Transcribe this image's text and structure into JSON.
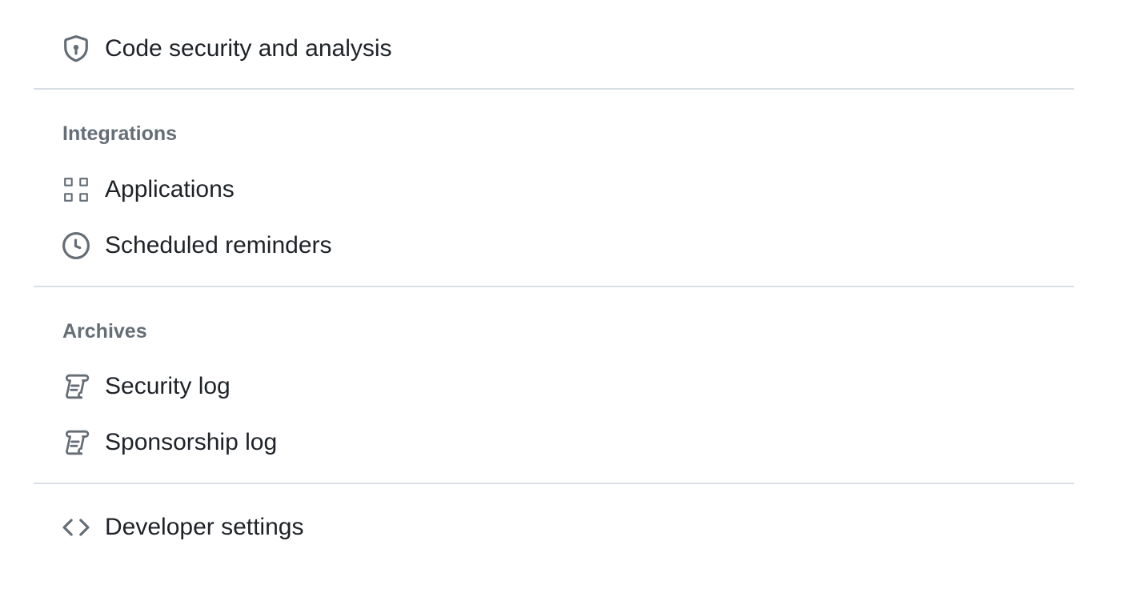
{
  "sections": {
    "security": {
      "items": [
        {
          "label": "Code security and analysis",
          "icon": "shield-lock-icon"
        }
      ]
    },
    "integrations": {
      "heading": "Integrations",
      "items": [
        {
          "label": "Applications",
          "icon": "apps-icon"
        },
        {
          "label": "Scheduled reminders",
          "icon": "clock-icon"
        }
      ]
    },
    "archives": {
      "heading": "Archives",
      "items": [
        {
          "label": "Security log",
          "icon": "log-icon"
        },
        {
          "label": "Sponsorship log",
          "icon": "log-icon"
        }
      ]
    },
    "developer": {
      "items": [
        {
          "label": "Developer settings",
          "icon": "code-icon"
        }
      ]
    }
  },
  "colors": {
    "text": "#1f2328",
    "muted": "#656d76",
    "divider": "#d8dee4"
  }
}
